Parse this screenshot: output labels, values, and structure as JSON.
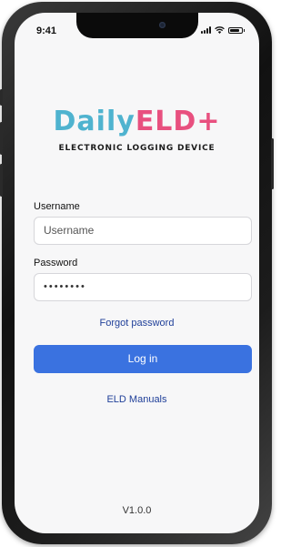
{
  "status_bar": {
    "time": "9:41",
    "icons": [
      "signal-icon",
      "wifi-icon",
      "battery-icon"
    ]
  },
  "logo": {
    "title_part1": "Daily",
    "title_part2": "ELD+",
    "subtitle": "ELECTRONIC LOGGING DEVICE",
    "colors": {
      "primary": "#4fb3cf",
      "accent": "#e8507f"
    }
  },
  "login_form": {
    "username_label": "Username",
    "username_placeholder": "Username",
    "password_label": "Password",
    "password_value": "••••••••",
    "forgot_password": "Forgot password",
    "login_button": "Log in"
  },
  "links": {
    "manuals": "ELD Manuals"
  },
  "footer": {
    "version": "V1.0.0"
  },
  "colors": {
    "button": "#3a72e0",
    "link": "#1f3f99"
  }
}
